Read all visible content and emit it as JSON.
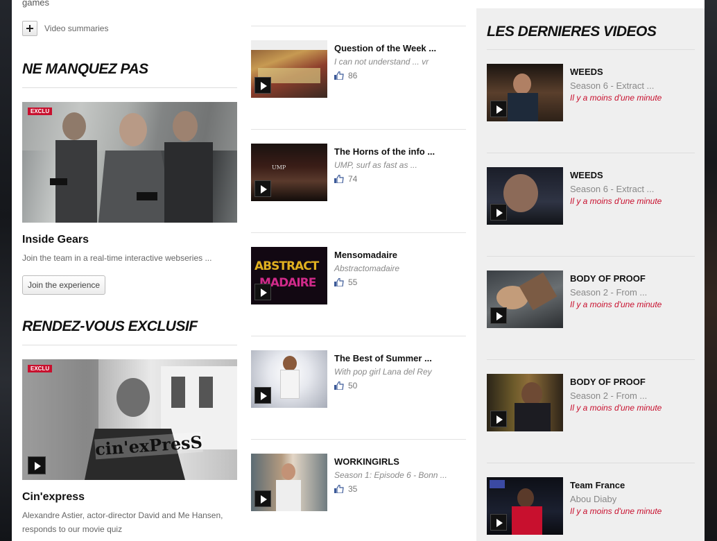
{
  "top": {
    "games": "games",
    "video_summaries": "Video summaries"
  },
  "ne_manquez": {
    "heading": "NE MANQUEZ PAS",
    "badge": "EXCLU",
    "title": "Inside Gears",
    "desc": "Join the team in a real-time interactive webseries ...",
    "button": "Join the experience"
  },
  "rendez_vous": {
    "heading": "RENDEZ-VOUS EXCLUSIF",
    "badge": "EXCLU",
    "overlay": "cin'exPresS",
    "title": "Cin'express",
    "desc": "Alexandre Astier, actor-director David and Me Hansen, responds to our movie quiz"
  },
  "middle": [
    {
      "title": "Question of the Week ...",
      "subtitle": "I can not understand ... vr",
      "likes": "86"
    },
    {
      "title": "The Horns of the info ...",
      "subtitle": "UMP, surf as fast as ...",
      "likes": "74"
    },
    {
      "title": "Mensomadaire",
      "subtitle": "Abstractomadaire",
      "likes": "55"
    },
    {
      "title": "The Best of Summer ...",
      "subtitle": "With pop girl Lana del Rey",
      "likes": "50"
    },
    {
      "title": "WORKINGIRLS",
      "subtitle": "Season 1: Episode 6 - Bonn ...",
      "likes": "35"
    }
  ],
  "latest": {
    "heading": "LES DERNIERES VIDEOS",
    "items": [
      {
        "title": "WEEDS",
        "subtitle": "Season 6 - Extract ...",
        "date": "Il y a moins d'une minute"
      },
      {
        "title": "WEEDS",
        "subtitle": "Season 6 - Extract ...",
        "date": "Il y a moins d'une minute"
      },
      {
        "title": "BODY OF PROOF",
        "subtitle": "Season 2 - From ...",
        "date": "Il y a moins d'une minute"
      },
      {
        "title": "BODY OF PROOF",
        "subtitle": "Season 2 - From ...",
        "date": "Il y a moins d'une minute"
      },
      {
        "title": "Team France",
        "subtitle": "Abou Diaby",
        "date": "Il y a moins d'une minute"
      }
    ]
  },
  "colors": {
    "accent": "#c8102e",
    "sidebar_bg": "#efefef",
    "like_blue": "#3b5998"
  }
}
